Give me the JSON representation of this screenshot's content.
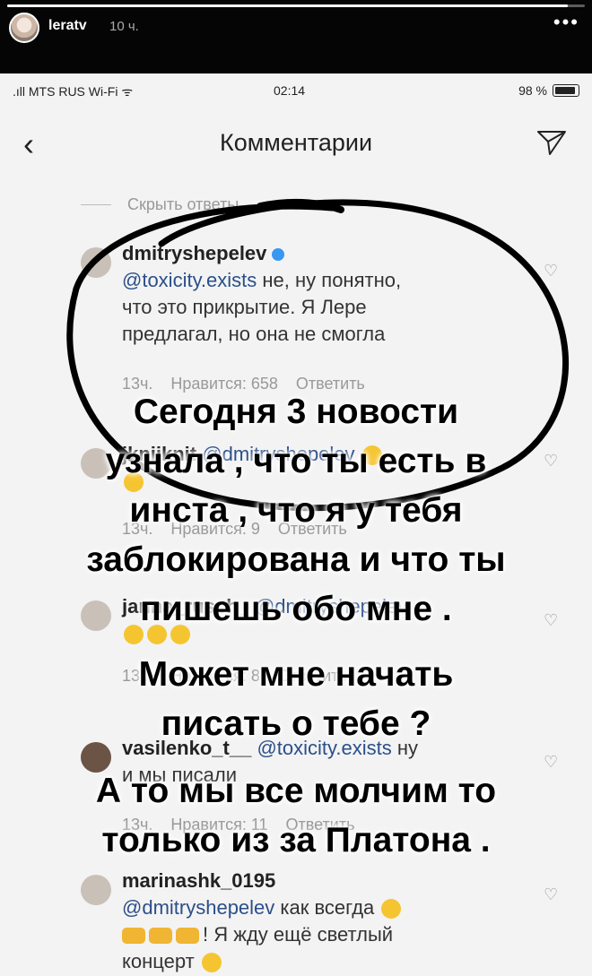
{
  "story": {
    "username": "leratv",
    "time": "10 ч.",
    "more": "•••",
    "progress": 0.97
  },
  "status_bar": {
    "carrier": ".ıll MTS RUS Wi-Fi ᯤ",
    "time": "02:14",
    "battery": "98 %"
  },
  "nav": {
    "back": "‹",
    "title": "Комментарии"
  },
  "hide_replies": "Скрыть ответы",
  "comments": [
    {
      "user": "dmitryshepelev",
      "mention": "@toxicity.exists",
      "text_line1": " не, ну понятно,",
      "text_line2": "что это прикрытие. Я Лере",
      "text_line3": "предлагал, но она не смогла",
      "time": "13ч.",
      "likes": "Нравится: 658",
      "reply": "Ответить"
    },
    {
      "user": "jknijknit",
      "mention": "@dmitryshepelev",
      "time": "13ч.",
      "likes": "Нравится: 9",
      "reply": "Ответить"
    },
    {
      "user": "janna_rusch_",
      "mention": "@dmitryshepelev",
      "time": "13ч.",
      "likes": "Нравится: 8",
      "reply": "Ответить"
    },
    {
      "user": "vasilenko_t__",
      "mention": "@toxicity.exists",
      "text_line1": " ну",
      "text_line2": "и мы писали",
      "time": "13ч.",
      "likes": "Нравится: 11",
      "reply": "Ответить"
    },
    {
      "user": "marinashk_0195",
      "mention": "@dmitryshepelev",
      "text_line1": " как всегда",
      "text_line2": "! Я жду ещё светлый",
      "text_line3": "концерт"
    }
  ],
  "overlay_lines": [
    "Сегодня 3 новости",
    "узнала , что ты есть в",
    "инста , что я у тебя",
    "заблокирована и что ты",
    "пишешь обо мне .",
    "Может мне начать",
    "писать о тебе ?",
    "А то мы все молчим то",
    "только из за Платона ."
  ],
  "colors": {
    "ink": "#000000",
    "mention": "#2b4f8a",
    "verified": "#3897f0"
  }
}
